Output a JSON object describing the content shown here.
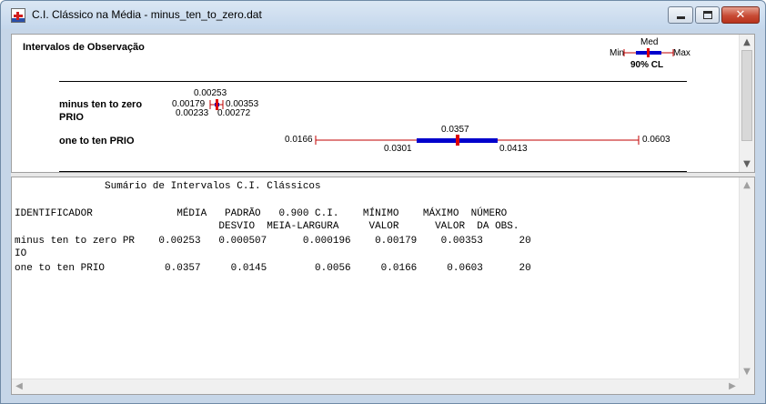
{
  "window": {
    "title": "C.I. Clássico na Média - minus_ten_to_zero.dat",
    "close_glyph": "✕"
  },
  "chart": {
    "header": "Intervalos de Observação",
    "legend": {
      "med": "Med",
      "min": "Min",
      "max": "Max",
      "cl": "90% CL"
    },
    "colors": {
      "range_line": "#c00000",
      "ci_bar": "#0000cc",
      "mean_marker": "#dd0000"
    }
  },
  "chart_data": {
    "type": "interval",
    "title": "Intervalos de Observação",
    "confidence_label": "90% CL",
    "series": [
      {
        "name_line1": "minus ten to zero",
        "name_line2": "PRIO",
        "labels": {
          "mean": "0.00253",
          "min": "0.00179",
          "max": "0.00353",
          "ci_low": "0.00233",
          "ci_high": "0.00272"
        },
        "mean": 0.00253,
        "min": 0.00179,
        "max": 0.00353,
        "ci_low": 0.00233,
        "ci_high": 0.00272
      },
      {
        "name_line1": "one to ten PRIO",
        "labels": {
          "mean": "0.0357",
          "min": "0.0166",
          "max": "0.0603",
          "ci_low": "0.0301",
          "ci_high": "0.0413"
        },
        "mean": 0.0357,
        "min": 0.0166,
        "max": 0.0603,
        "ci_low": 0.0301,
        "ci_high": 0.0413
      }
    ]
  },
  "report": {
    "title": "Sumário de Intervalos C.I. Clássicos",
    "header_line1": "IDENTIFICADOR              MÉDIA   PADRÃO   0.900 C.I.    MÍNIMO    MÁXIMO  NÚMERO",
    "header_line2": "                                  DESVIO  MEIA-LARGURA     VALOR      VALOR  DA OBS.",
    "rows": [
      "minus ten to zero PR    0.00253   0.000507      0.000196    0.00179    0.00353      20",
      "IO",
      "one to ten PRIO          0.0357     0.0145        0.0056     0.0166     0.0603      20"
    ]
  }
}
